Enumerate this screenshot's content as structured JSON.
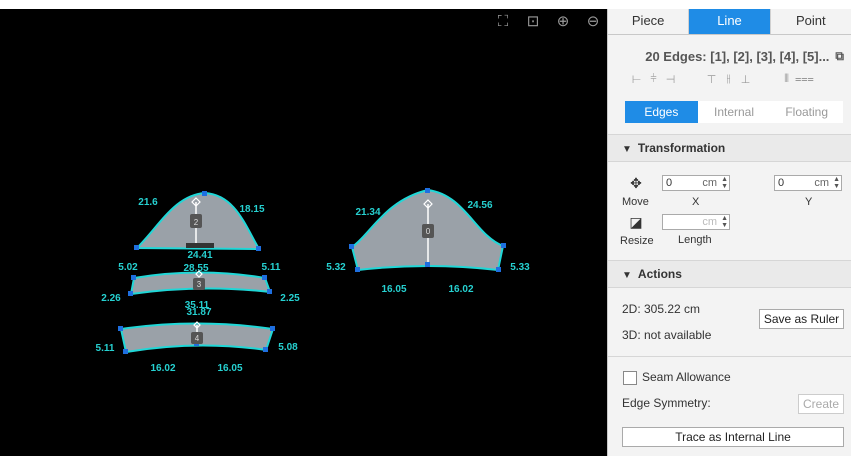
{
  "viewport": {
    "tools": [
      {
        "name": "fit-view-icon",
        "glyph": "⛶"
      },
      {
        "name": "zoom-selection-icon",
        "glyph": "⊡"
      },
      {
        "name": "zoom-in-icon",
        "glyph": "⊕"
      },
      {
        "name": "zoom-out-icon",
        "glyph": "⊖"
      }
    ],
    "pieces": {
      "p2": {
        "id": "2",
        "top_left": "21.6",
        "top_right": "18.15",
        "bottom": "24.41"
      },
      "p3": {
        "id": "3",
        "left_top": "5.02",
        "top": "28.55",
        "right_top": "5.11",
        "left_bottom": "2.26",
        "right_bottom": "2.25",
        "bottom": "35.11"
      },
      "p4": {
        "id": "4",
        "top": "31.87",
        "left": "5.11",
        "right": "5.08",
        "bottom_left": "16.02",
        "bottom_right": "16.05"
      },
      "p0": {
        "id": "0",
        "top_left": "21.34",
        "top_right": "24.56",
        "left": "5.32",
        "right": "5.33",
        "bottom_left": "16.05",
        "bottom_right": "16.02"
      }
    },
    "colors": {
      "edge": "#20d7d7",
      "point": "#1e6fe0",
      "fill": "#9aa1a8",
      "label": "#26d1d1"
    }
  },
  "panel": {
    "tabs": [
      "Piece",
      "Line",
      "Point"
    ],
    "active_tab": "Line",
    "edges_summary": "20 Edges: [1], [2], [3], [4], [5]...",
    "subtabs": [
      "Edges",
      "Internal",
      "Floating"
    ],
    "active_subtab": "Edges",
    "transformation": {
      "title": "Transformation",
      "move_label": "Move",
      "x_value": "0",
      "x_unit": "cm",
      "x_label": "X",
      "y_value": "0",
      "y_unit": "cm",
      "y_label": "Y",
      "resize_label": "Resize",
      "length_unit": "cm",
      "length_label": "Length"
    },
    "actions": {
      "title": "Actions",
      "length_2d": "2D: 305.22 cm",
      "length_3d": "3D: not available",
      "save_ruler": "Save as Ruler",
      "seam_allowance": "Seam Allowance",
      "edge_symmetry": "Edge Symmetry:",
      "create": "Create",
      "trace": "Trace as Internal Line"
    },
    "accent": "#1f8ce6"
  }
}
